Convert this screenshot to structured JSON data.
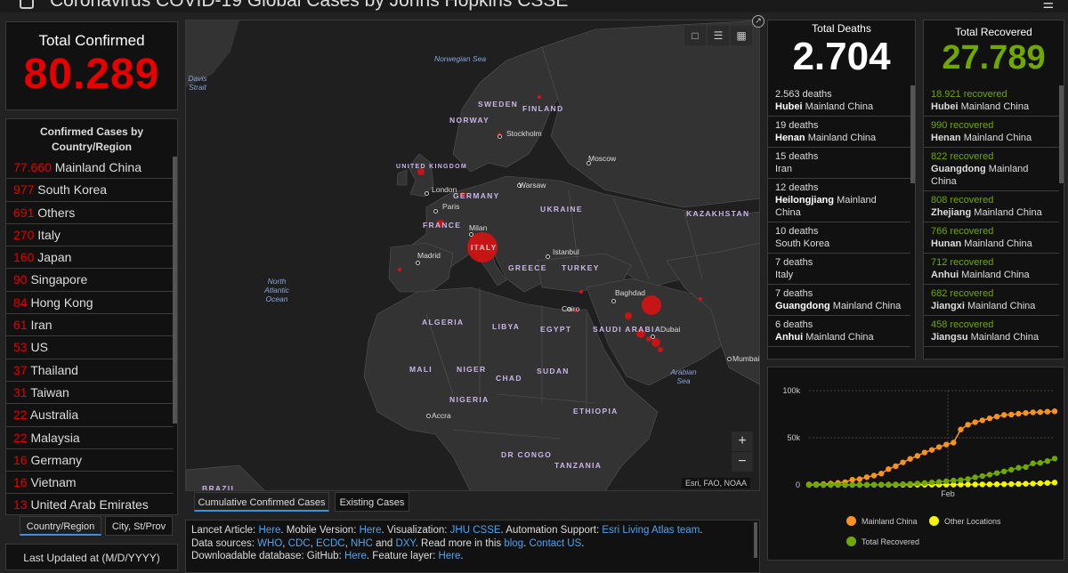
{
  "header": {
    "title": "Coronavirus COVID-19 Global Cases by Johns Hopkins CSSE"
  },
  "total_confirmed": {
    "label": "Total Confirmed",
    "value": "80.289"
  },
  "country_panel": {
    "title": "Confirmed Cases by Country/Region",
    "rows": [
      {
        "count": "77.660",
        "name": "Mainland China"
      },
      {
        "count": "977",
        "name": "South Korea"
      },
      {
        "count": "691",
        "name": "Others"
      },
      {
        "count": "270",
        "name": "Italy"
      },
      {
        "count": "160",
        "name": "Japan"
      },
      {
        "count": "90",
        "name": "Singapore"
      },
      {
        "count": "84",
        "name": "Hong Kong"
      },
      {
        "count": "61",
        "name": "Iran"
      },
      {
        "count": "53",
        "name": "US"
      },
      {
        "count": "37",
        "name": "Thailand"
      },
      {
        "count": "31",
        "name": "Taiwan"
      },
      {
        "count": "22",
        "name": "Australia"
      },
      {
        "count": "22",
        "name": "Malaysia"
      },
      {
        "count": "16",
        "name": "Germany"
      },
      {
        "count": "16",
        "name": "Vietnam"
      },
      {
        "count": "13",
        "name": "United Arab Emirates"
      }
    ]
  },
  "left_tabs": {
    "tab1": "Country/Region",
    "tab2": "City, St/Prov"
  },
  "last_updated": {
    "label": "Last Updated at (M/D/YYYY)"
  },
  "map": {
    "attribution": "Esri, FAO, NOAA",
    "zoom_in": "+",
    "zoom_out": "−",
    "country_labels": [
      "SWEDEN",
      "FINLAND",
      "NORWAY",
      "UNITED KINGDOM",
      "GERMANY",
      "FRANCE",
      "UKRAINE",
      "KAZAKHSTAN",
      "ITALY",
      "GREECE",
      "TURKEY",
      "ALGERIA",
      "LIBYA",
      "EGYPT",
      "SAUDI ARABIA",
      "MALI",
      "NIGER",
      "CHAD",
      "SUDAN",
      "NIGERIA",
      "ETHIOPIA",
      "DR CONGO",
      "TANZANIA",
      "BRAZIL"
    ],
    "oceans": [
      "Norwegian Sea",
      "North Atlantic Ocean",
      "Arabian Sea"
    ],
    "strait": "Davis Strait",
    "cities": [
      "Stockholm",
      "Moscow",
      "London",
      "Paris",
      "Warsaw",
      "Milan",
      "Madrid",
      "Istanbul",
      "Baghdad",
      "Cairo",
      "Dubai",
      "Accra",
      "Mumbai"
    ]
  },
  "map_tabs": {
    "tab1": "Cumulative Confirmed Cases",
    "tab2": "Existing Cases"
  },
  "info": {
    "line1_prefix": "Lancet Article: ",
    "line1_link1": "Here",
    "line1_mid1": ". Mobile Version: ",
    "line1_link2": "Here",
    "line1_mid2": ". Visualization: ",
    "line1_link3": "JHU CSSE",
    "line1_mid3": ". Automation Support: ",
    "line1_link4": "Esri Living Atlas team",
    "line1_end": ".",
    "line2_prefix": "Data sources: ",
    "line2_link1": "WHO",
    "line2_sep1": ", ",
    "line2_link2": "CDC",
    "line2_sep2": ", ",
    "line2_link3": "ECDC",
    "line2_sep3": ", ",
    "line2_link4": "NHC",
    "line2_and": " and ",
    "line2_link5": "DXY",
    "line2_mid": ". Read more in this ",
    "line2_link6": "blog",
    "line2_sep4": ". ",
    "line2_link7": "Contact US",
    "line2_end": ".",
    "line3_prefix": "Downloadable database: GitHub: ",
    "line3_link1": "Here",
    "line3_mid": ". Feature layer: ",
    "line3_link2": "Here",
    "line3_end": "."
  },
  "total_deaths": {
    "label": "Total Deaths",
    "value": "2.704",
    "rows": [
      {
        "count": "2.563 deaths",
        "region": "Hubei",
        "country": "Mainland China"
      },
      {
        "count": "19 deaths",
        "region": "Henan",
        "country": "Mainland China"
      },
      {
        "count": "15 deaths",
        "region": "",
        "country": "Iran"
      },
      {
        "count": "12 deaths",
        "region": "Heilongjiang",
        "country": "Mainland China"
      },
      {
        "count": "10 deaths",
        "region": "",
        "country": "South Korea"
      },
      {
        "count": "7 deaths",
        "region": "",
        "country": "Italy"
      },
      {
        "count": "7 deaths",
        "region": "Guangdong",
        "country": "Mainland China"
      },
      {
        "count": "6 deaths",
        "region": "Anhui",
        "country": "Mainland China"
      }
    ]
  },
  "total_recovered": {
    "label": "Total Recovered",
    "value": "27.789",
    "rows": [
      {
        "count": "18.921 recovered",
        "region": "Hubei",
        "country": "Mainland China"
      },
      {
        "count": "990 recovered",
        "region": "Henan",
        "country": "Mainland China"
      },
      {
        "count": "822 recovered",
        "region": "Guangdong",
        "country": "Mainland China"
      },
      {
        "count": "808 recovered",
        "region": "Zhejiang",
        "country": "Mainland China"
      },
      {
        "count": "766 recovered",
        "region": "Hunan",
        "country": "Mainland China"
      },
      {
        "count": "712 recovered",
        "region": "Anhui",
        "country": "Mainland China"
      },
      {
        "count": "682 recovered",
        "region": "Jiangxi",
        "country": "Mainland China"
      },
      {
        "count": "458 recovered",
        "region": "Jiangsu",
        "country": "Mainland China"
      }
    ]
  },
  "colors": {
    "confirmed": "#e60000",
    "recovered": "#70a800",
    "mainland_china": "#f7931e",
    "other_locations": "#f5f500",
    "link": "#4ea4f0"
  },
  "chart_data": {
    "type": "line",
    "y_ticks": [
      "0",
      "50k",
      "100k"
    ],
    "ylim": [
      0,
      100000
    ],
    "x_tick_label": "Feb",
    "series": [
      {
        "name": "Mainland China",
        "color": "#f7931e",
        "values": [
          555,
          653,
          941,
          1438,
          2118,
          2927,
          5578,
          6165,
          8235,
          9925,
          12038,
          16787,
          19881,
          23892,
          27636,
          30818,
          34392,
          37121,
          40151,
          42763,
          44803,
          58761,
          63851,
          66492,
          68500,
          70548,
          72436,
          74185,
          74576,
          75465,
          76288,
          76936,
          77150,
          77658,
          78064
        ]
      },
      {
        "name": "Other Locations",
        "color": "#f5f500",
        "values": [
          0,
          0,
          0,
          0,
          0,
          0,
          0,
          0,
          0,
          100,
          120,
          130,
          150,
          160,
          180,
          210,
          240,
          250,
          280,
          300,
          350,
          400,
          450,
          500,
          550,
          620,
          700,
          800,
          900,
          1000,
          1200,
          1400,
          1700,
          2100,
          2500
        ]
      },
      {
        "name": "Total Recovered",
        "color": "#70a800",
        "values": [
          28,
          30,
          36,
          39,
          52,
          61,
          107,
          126,
          143,
          222,
          284,
          472,
          623,
          852,
          1124,
          1487,
          2011,
          2616,
          3244,
          3946,
          4683,
          5150,
          6295,
          8058,
          9395,
          10865,
          12583,
          14352,
          16121,
          18177,
          18890,
          22886,
          23394,
          25227,
          27905
        ]
      }
    ]
  }
}
